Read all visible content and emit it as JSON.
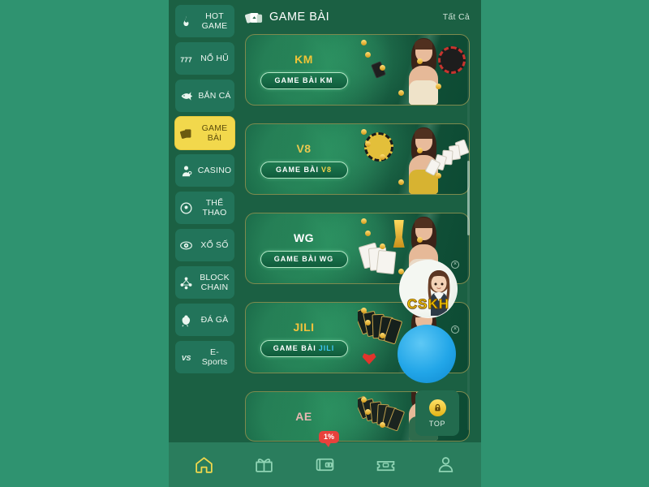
{
  "theme": {
    "page_bg": "#2f9370",
    "app_bg": "#1b6043",
    "sidebar_item_bg": "#22745a",
    "active_item_bg": "#f2d84c",
    "active_item_text": "#5c4d0c",
    "nav_bg": "#2a7d5d",
    "nav_active": "#f2d84c",
    "nav_inactive": "#8fd4b4",
    "badge_red": "#e8413c",
    "accent_blue": "#22a6e8",
    "cskh_text": "#ffd700"
  },
  "sidebar": {
    "items": [
      {
        "label_line1": "HOT",
        "label_line2": "GAME",
        "icon": "flame-icon",
        "active": false
      },
      {
        "label_line1": "NỔ HŨ",
        "label_line2": "",
        "icon": "slot-777-icon",
        "active": false
      },
      {
        "label_line1": "BẮN CÁ",
        "label_line2": "",
        "icon": "fish-icon",
        "active": false
      },
      {
        "label_line1": "GAME",
        "label_line2": "BÀI",
        "icon": "playing-cards-icon",
        "active": true
      },
      {
        "label_line1": "CASINO",
        "label_line2": "",
        "icon": "dealer-icon",
        "active": false
      },
      {
        "label_line1": "THỂ",
        "label_line2": "THAO",
        "icon": "soccer-ball-icon",
        "active": false
      },
      {
        "label_line1": "XỔ SỐ",
        "label_line2": "",
        "icon": "lottery-ball-icon",
        "active": false
      },
      {
        "label_line1": "BLOCK",
        "label_line2": "CHAIN",
        "icon": "blockchain-icon",
        "active": false
      },
      {
        "label_line1": "ĐÁ GÀ",
        "label_line2": "",
        "icon": "rooster-icon",
        "active": false
      },
      {
        "label_line1": "E-",
        "label_line2": "Sports",
        "icon": "versus-icon",
        "active": false
      }
    ]
  },
  "header": {
    "icon": "playing-cards-icon",
    "title": "GAME BÀI",
    "all_label": "Tất Cả"
  },
  "cards": [
    {
      "logo": "KM",
      "logo_color": "#f0c437",
      "pill_text": "GAME BÀI",
      "pill_tag": "KM",
      "pill_tag_color": "#ffffff",
      "dress_color": "#efe3c9"
    },
    {
      "logo": "V8",
      "logo_color": "#e9c84f",
      "pill_text": "GAME BÀI",
      "pill_tag": "V8",
      "pill_tag_color": "#f5d44a",
      "dress_color": "#d7b331"
    },
    {
      "logo": "WG",
      "logo_color": "#ffffff",
      "pill_text": "GAME BÀI",
      "pill_tag": "WG",
      "pill_tag_color": "#ffffff",
      "dress_color": "#e9d9c6"
    },
    {
      "logo": "JILI",
      "logo_color": "#f3c23c",
      "pill_text": "GAME BÀI",
      "pill_tag": "JILI",
      "pill_tag_color": "#3fc8f5",
      "dress_color": "#2f9c62"
    },
    {
      "logo": "AE",
      "logo_color": "#e9b7b2",
      "pill_text": "",
      "pill_tag": "",
      "pill_tag_color": "#ffffff",
      "dress_color": "#2e6b4c"
    }
  ],
  "floating": {
    "percent_badge": "1%",
    "top_button": {
      "label": "TOP",
      "icon": "lock-icon"
    },
    "cskh": {
      "label": "CSKH",
      "icon": "support-agent-icon",
      "close": "×"
    },
    "blue_fab": {
      "icon": "blue-circle-icon",
      "close": "×"
    }
  },
  "bottom_nav": {
    "items": [
      {
        "icon": "home-icon",
        "active": true
      },
      {
        "icon": "gift-icon",
        "active": false
      },
      {
        "icon": "wallet-icon",
        "active": false
      },
      {
        "icon": "ticket-icon",
        "active": false
      },
      {
        "icon": "profile-icon",
        "active": false
      }
    ]
  }
}
